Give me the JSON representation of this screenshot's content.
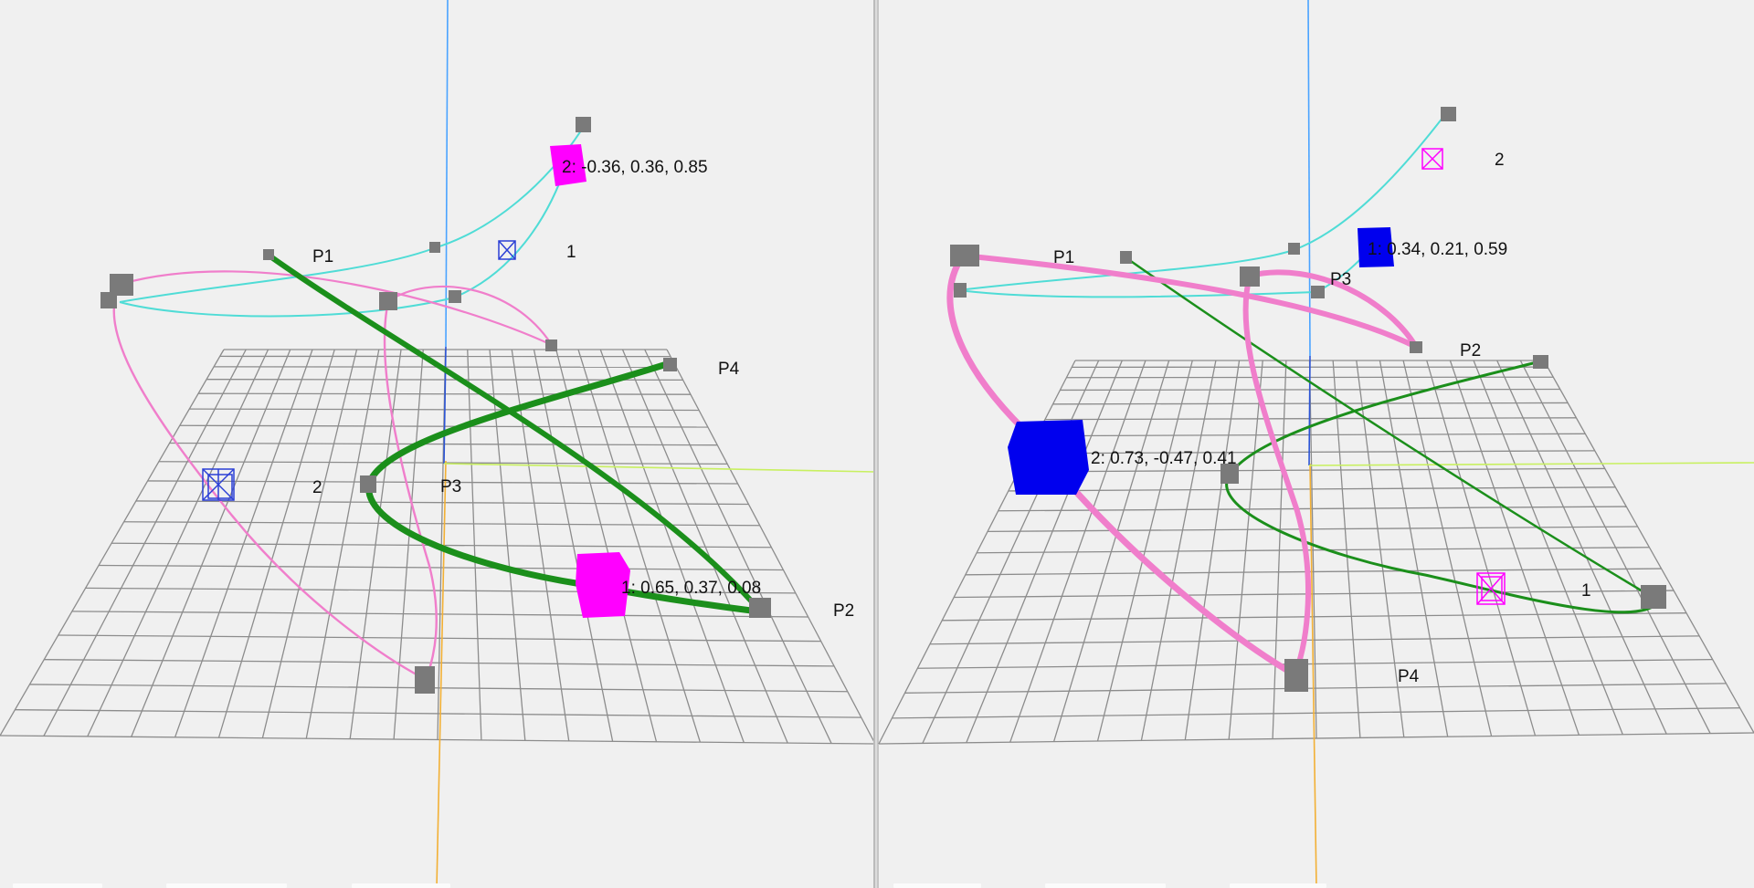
{
  "viewports": [
    {
      "name": "left",
      "labels": {
        "p1": "P1",
        "p2": "P2",
        "p3": "P3",
        "p4": "P4",
        "marker_1": "1",
        "marker_2": "2",
        "readout_1": "1: 0.65, 0.37, 0.08",
        "readout_2": "2: -0.36, 0.36, 0.85"
      }
    },
    {
      "name": "right",
      "labels": {
        "p1": "P1",
        "p2": "P2",
        "p3": "P3",
        "p4": "P4",
        "marker_1": "1",
        "marker_2": "2",
        "readout_1": "1: 0.34, 0.21, 0.59",
        "readout_2": "2: 0.73, -0.47, 0.41"
      }
    }
  ],
  "colors": {
    "background": "#f0f0f0",
    "grid": "#8c8c8c",
    "divider": "#9a9a9a",
    "axis_y_up": "#4aa3ff",
    "axis_y_down": "#f2b035",
    "axis_x": "#c8f060",
    "axis_z": "#2b54d6",
    "curve_green": "#1b8f1b",
    "curve_pink": "#f07ecb",
    "curve_cyan": "#4fdcd6",
    "marker_magenta": "#ff00ff",
    "marker_blue": "#0000ee",
    "control_point": "#7a7a7a",
    "text": "#111111"
  },
  "icons": {
    "solid_marker": "filled-cube",
    "ghost_marker": "wireframe-cube",
    "control_point": "grey-cube"
  }
}
